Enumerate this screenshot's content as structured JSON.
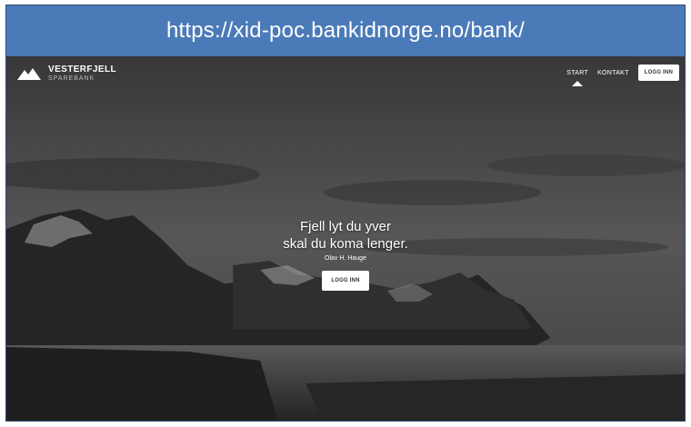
{
  "browser": {
    "url": "https://xid-poc.bankidnorge.no/bank/"
  },
  "site": {
    "brand_name": "VESTERFJELL",
    "brand_sub": "SPAREBANK"
  },
  "nav": {
    "start": "START",
    "kontakt": "KONTAKT",
    "login": "LOGG INN"
  },
  "hero": {
    "line1": "Fjell lyt du yver",
    "line2": "skal du koma lenger.",
    "author": "Olav H. Hauge",
    "button": "LOGG INN"
  },
  "icons": {
    "logo": "mountain-logo-icon",
    "nav_indicator": "triangle-up-icon"
  },
  "colors": {
    "url_bar": "#4b7ab8",
    "hero_bg": "#2a2a2a",
    "button_bg": "#ffffff"
  }
}
